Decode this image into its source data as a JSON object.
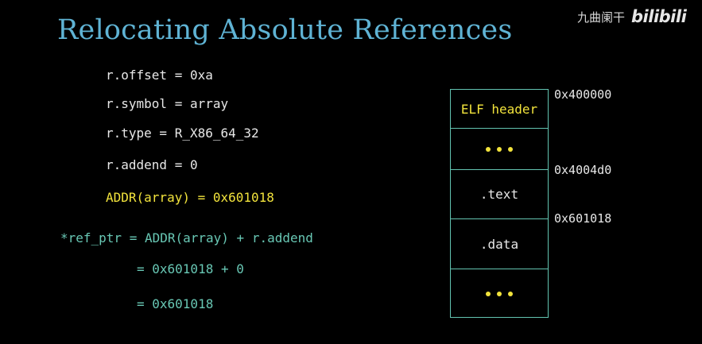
{
  "slide": {
    "title": "Relocating Absolute References",
    "watermark": {
      "text": "九曲阑干",
      "logo": "bilibili"
    }
  },
  "relocation_entry": {
    "offset_line": "r.offset = 0xa",
    "symbol_line": "r.symbol = array",
    "type_line": "r.type = R_X86_64_32",
    "addend_line": "r.addend = 0"
  },
  "resolved_address": "ADDR(array) = 0x601018",
  "computation": {
    "line1": "*ref_ptr = ADDR(array) + r.addend",
    "line2": "= 0x601018 + 0",
    "line3": "= 0x601018"
  },
  "memory_layout": {
    "sections": [
      {
        "label": "ELF header"
      },
      {
        "label": "..."
      },
      {
        "label": ".text"
      },
      {
        "label": ".data"
      },
      {
        "label": "..."
      }
    ],
    "addresses": [
      "0x400000",
      "0x4004d0",
      "0x601018"
    ]
  },
  "colors": {
    "background": "#000000",
    "title": "#5fb3d4",
    "highlight_yellow": "#f2e33c",
    "highlight_teal": "#68c7b4",
    "box_border": "#63c4b1",
    "text": "#e8e8e8"
  }
}
